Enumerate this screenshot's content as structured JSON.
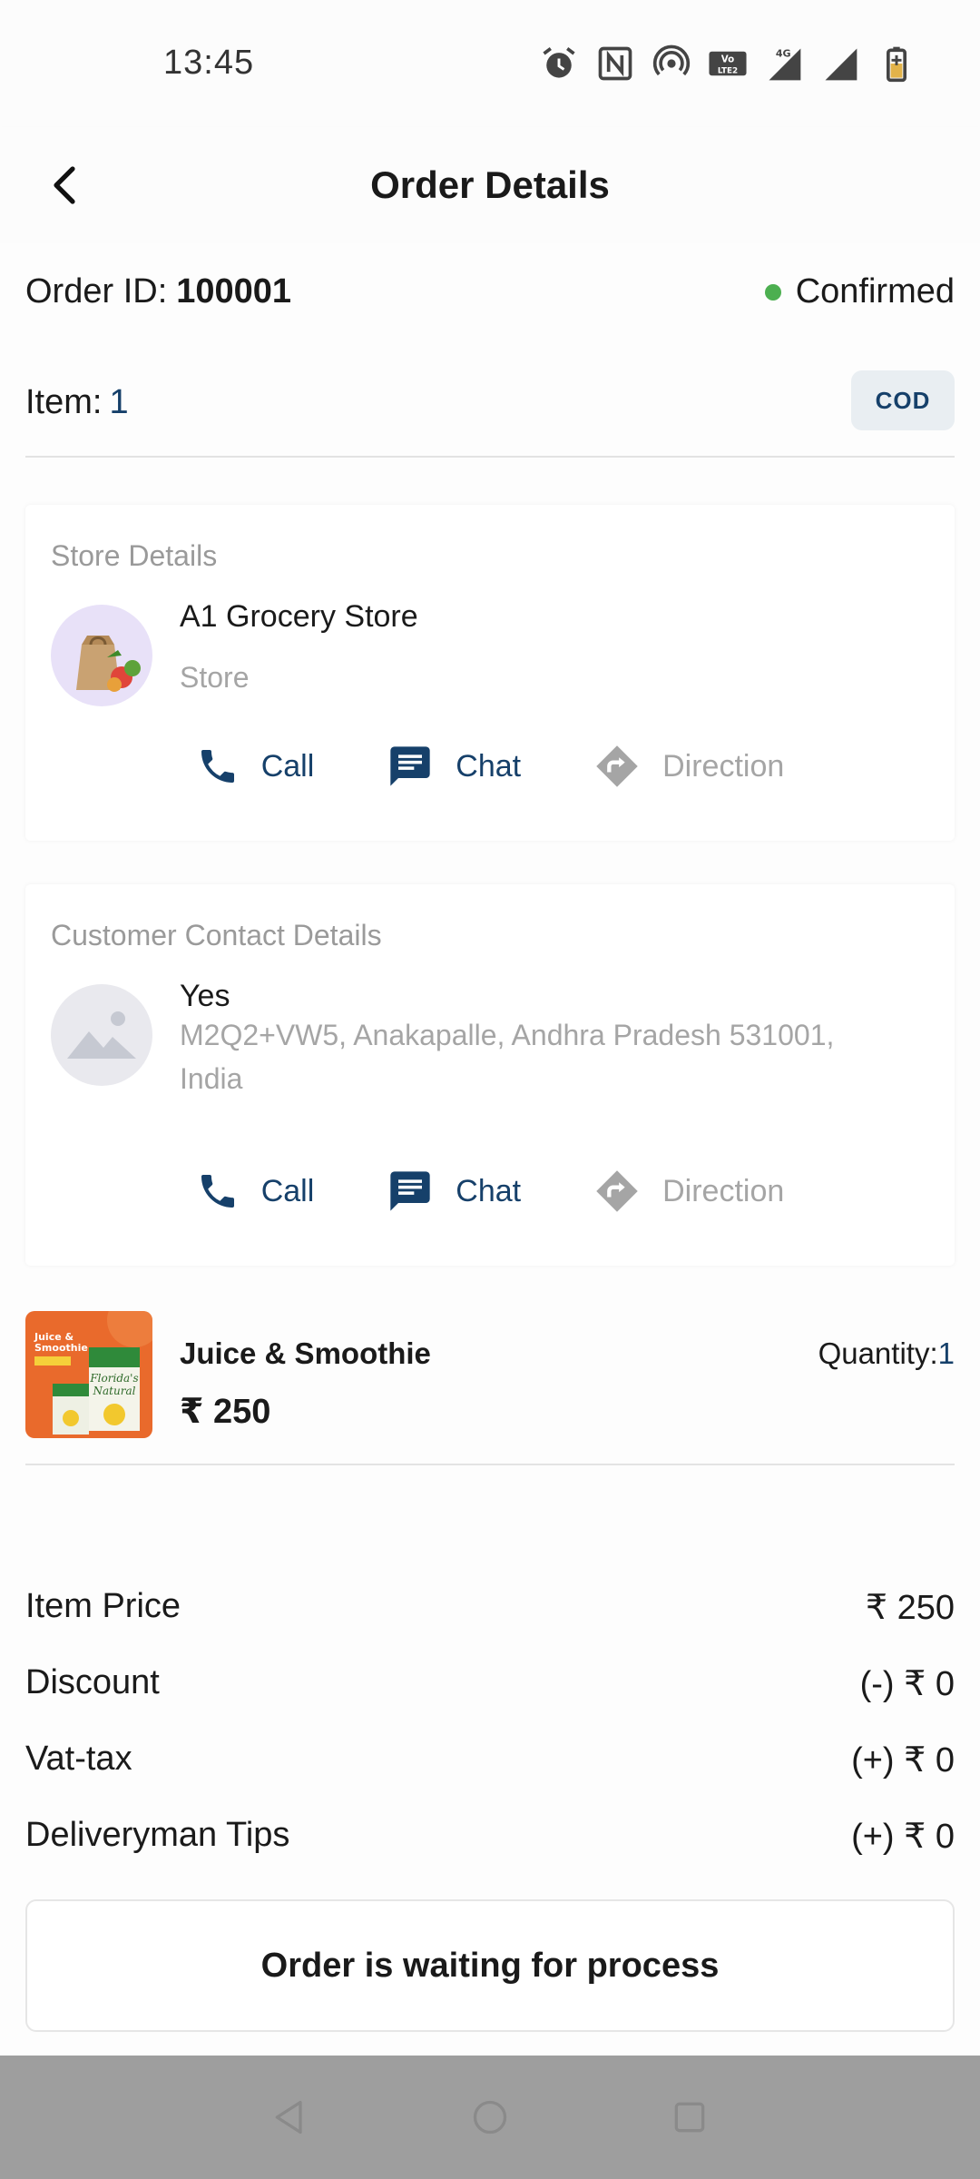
{
  "status_bar": {
    "time": "13:45",
    "icons": [
      "alarm-icon",
      "nfc-icon",
      "hotspot-icon",
      "volte-icon",
      "signal-4g-icon",
      "signal-icon",
      "battery-charging-icon"
    ]
  },
  "header": {
    "title": "Order Details"
  },
  "order": {
    "id_label": "Order ID:",
    "id_value": "100001",
    "status": "Confirmed",
    "status_color": "#4caf50",
    "item_label": "Item:",
    "item_count": "1",
    "payment_badge": "COD"
  },
  "store_card": {
    "heading": "Store Details",
    "name": "A1 Grocery Store",
    "subtitle": "Store",
    "actions": {
      "call": "Call",
      "chat": "Chat",
      "direction": "Direction"
    }
  },
  "customer_card": {
    "heading": "Customer Contact Details",
    "name": "Yes",
    "address": "M2Q2+VW5, Anakapalle, Andhra Pradesh 531001, India",
    "actions": {
      "call": "Call",
      "chat": "Chat",
      "direction": "Direction"
    }
  },
  "product": {
    "name": "Juice & Smoothie",
    "price": "₹ 250",
    "quantity_label": "Quantity:",
    "quantity_value": "1",
    "image_text": [
      "Juice &",
      "Smoothie",
      "Florida's",
      "Natural"
    ]
  },
  "summary": [
    {
      "label": "Item Price",
      "value": "₹ 250"
    },
    {
      "label": "Discount",
      "value": "(-) ₹ 0"
    },
    {
      "label": "Vat-tax",
      "value": "(+) ₹ 0"
    },
    {
      "label": "Deliveryman Tips",
      "value": "(+) ₹ 0"
    }
  ],
  "process_message": "Order is waiting for process",
  "colors": {
    "accent": "#16406a",
    "muted": "#a5a5a5",
    "confirmed": "#4caf50"
  }
}
